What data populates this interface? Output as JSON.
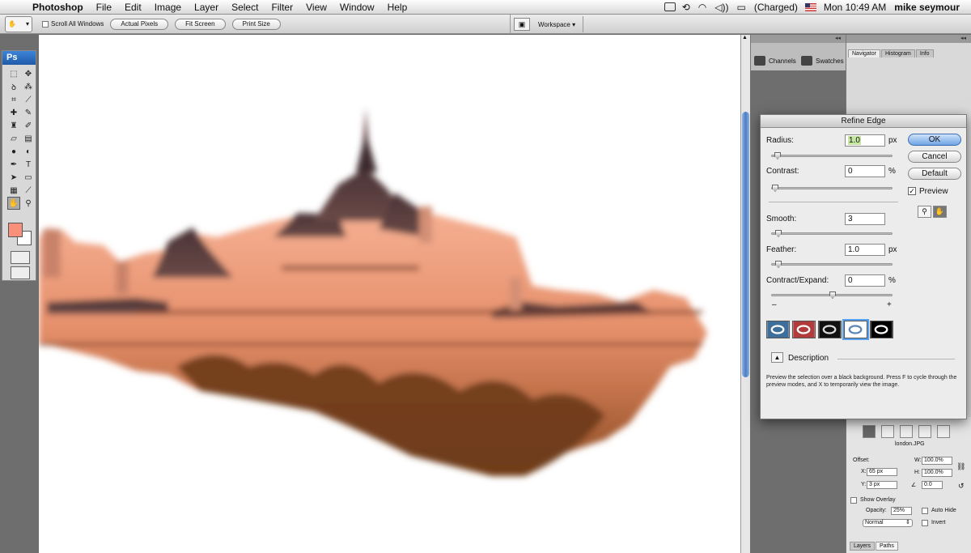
{
  "menubar": {
    "app": "Photoshop",
    "items": [
      "File",
      "Edit",
      "Image",
      "Layer",
      "Select",
      "Filter",
      "View",
      "Window",
      "Help"
    ],
    "battery": "(Charged)",
    "clock": "Mon 10:49 AM",
    "user": "mike seymour"
  },
  "options_bar": {
    "scroll_all_windows": "Scroll All Windows",
    "actual_pixels": "Actual Pixels",
    "fit_screen": "Fit Screen",
    "print_size": "Print Size",
    "workspace": "Workspace ▾"
  },
  "tools": {
    "logo": "Ps",
    "foreground_color": "#f9917a",
    "background_color": "#ffffff"
  },
  "dock": {
    "channels": "Channels",
    "swatches": "Swatches"
  },
  "navigator": {
    "tabs": [
      "Navigator",
      "Histogram",
      "Info"
    ]
  },
  "clone_source": {
    "filename": "london.JPG",
    "offset_label": "Offset:",
    "x_label": "X:",
    "x_value": "65 px",
    "y_label": "Y:",
    "y_value": "3 px",
    "w_label": "W:",
    "w_value": "100.0%",
    "h_label": "H:",
    "h_value": "100.0%",
    "angle_value": "0.0",
    "show_overlay": "Show Overlay",
    "opacity_label": "Opacity:",
    "opacity_value": "25%",
    "auto_hide": "Auto Hide",
    "blend_mode": "Normal",
    "invert": "Invert"
  },
  "bottom_tabs": [
    "Layers",
    "Paths"
  ],
  "refine_edge": {
    "title": "Refine Edge",
    "radius_label": "Radius:",
    "radius_value": "1.0",
    "radius_unit": "px",
    "contrast_label": "Contrast:",
    "contrast_value": "0",
    "contrast_unit": "%",
    "smooth_label": "Smooth:",
    "smooth_value": "3",
    "feather_label": "Feather:",
    "feather_value": "1.0",
    "feather_unit": "px",
    "contract_label": "Contract/Expand:",
    "contract_value": "0",
    "contract_unit": "%",
    "minus": "–",
    "plus": "+",
    "ok": "OK",
    "cancel": "Cancel",
    "default": "Default",
    "preview_label": "Preview",
    "description_label": "Description",
    "description_text": "Preview the selection over a black background. Press F to cycle through the preview modes, and X to temporarily view the image.",
    "slider_levels": {
      "radius": 0.02,
      "contrast": 0.0,
      "smooth": 0.03,
      "feather": 0.03,
      "contract": 0.5
    }
  }
}
